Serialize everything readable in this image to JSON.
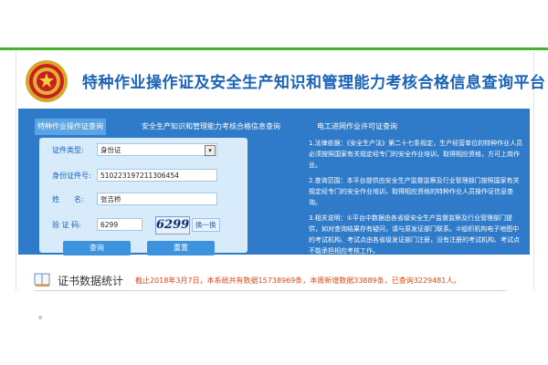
{
  "header": {
    "site_title": "特种作业操作证及安全生产知识和管理能力考核合格信息查询平台",
    "emblem": "national-emblem-icon"
  },
  "tabs": [
    {
      "label": "特种作业操作证查询",
      "active": true
    },
    {
      "label": "安全生产知识和管理能力考核合格信息查询",
      "active": false
    },
    {
      "label": "电工进网作业许可证查询",
      "active": false
    }
  ],
  "form": {
    "cert_type_label": "证件类型:",
    "cert_type_value": "身份证",
    "id_label": "身份证件号:",
    "id_value": "510223197211306454",
    "name_label": "姓　　名:",
    "name_value": "张吉桥",
    "captcha_label": "验 证 码:",
    "captcha_input": "6299",
    "captcha_image_text": "6299",
    "refresh_label": "换一换",
    "query_button": "查询",
    "reset_button": "重置"
  },
  "notes": [
    "1.法律依据：《安全生产法》第二十七条规定，生产经营单位的特种作业人员必须按照国家有关规定经专门的安全作业培训，取得相应资格，方可上岗作业。",
    "2.查询范围：本平台提供由安全生产监督监察及行业管理部门按照国家有关规定经专门的安全作业培训，取得相应资格的特种作业人员操作证信息查询。",
    "3.相关说明：①平台中数据由各省级安全生产监督监察及行业管理部门提供，如对查询结果存有疑问，请与原发证部门联系。②组织机构电子地图中的考试机构、考试点由各省级发证部门注册，没有注册的考试机构、考试点不能承担相应考核工作。"
  ],
  "stats": {
    "title": "证书数据统计",
    "text": "截止2018年3月7日，本系统共有数据15738969条，本周新增数据33889条，已查询3229481人。",
    "icon": "book-icon"
  },
  "colors": {
    "brand_blue": "#2f7bc9",
    "accent_green": "#4caf2a",
    "stats_orange": "#e04a1a"
  }
}
